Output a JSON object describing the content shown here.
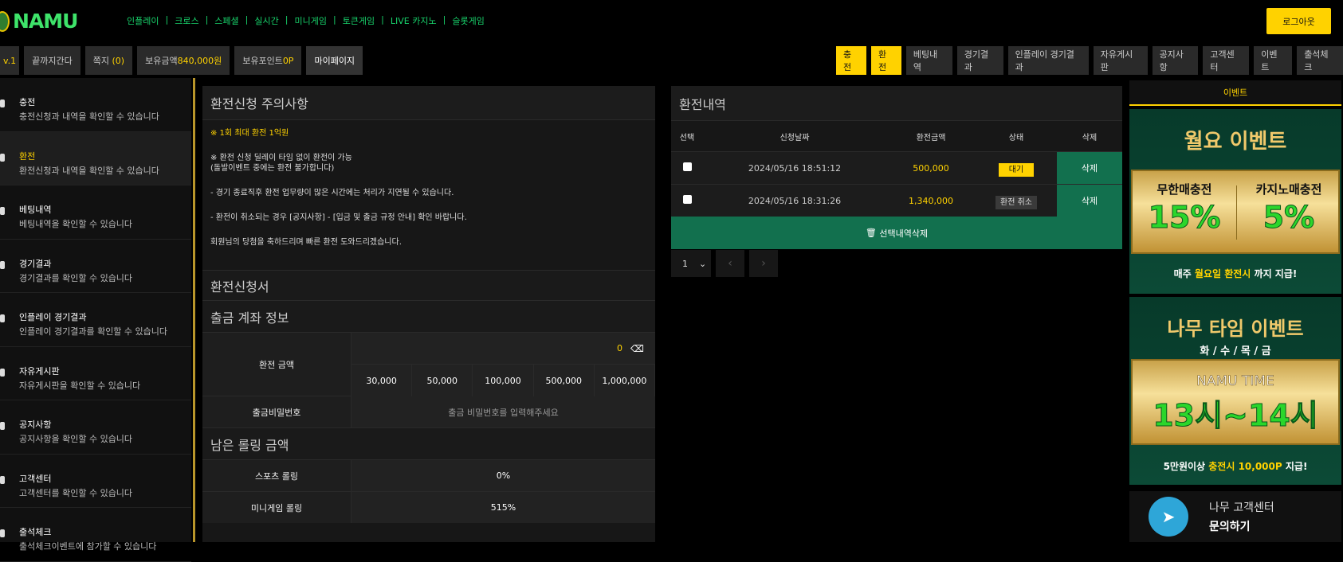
{
  "brand": {
    "name": "NAMU"
  },
  "gnb": [
    "인플레이",
    "크로스",
    "스페셜",
    "실시간",
    "미니게임",
    "토큰게임",
    "LIVE 카지노",
    "슬롯게임"
  ],
  "logout": "로그아웃",
  "userbar": {
    "level": "v.1",
    "nick": "끝까지간다",
    "msg_label": "쪽지",
    "msg_count": "(0)",
    "money_label": "보유금액",
    "money": "840,000원",
    "point_label": "보유포인트",
    "point": "0P",
    "mypage": "마이페이지"
  },
  "rnav": [
    "충전",
    "환전",
    "베팅내역",
    "경기결과",
    "인플레이 경기결과",
    "자유게시판",
    "공지사항",
    "고객센터",
    "이벤트",
    "출석체크"
  ],
  "side": [
    {
      "t": "충전",
      "d": "충전신청과 내역을 확인할 수 있습니다"
    },
    {
      "t": "환전",
      "d": "환전신청과 내역을 확인할 수 있습니다"
    },
    {
      "t": "베팅내역",
      "d": "베팅내역을 확인할 수 있습니다"
    },
    {
      "t": "경기결과",
      "d": "경기결과를 확인할 수 있습니다"
    },
    {
      "t": "인플레이 경기결과",
      "d": "인플레이 경기결과를 확인할 수 있습니다"
    },
    {
      "t": "자유게시판",
      "d": "자유게시판을 확인할 수 있습니다"
    },
    {
      "t": "공지사항",
      "d": "공지사항을 확인할 수 있습니다"
    },
    {
      "t": "고객센터",
      "d": "고객센터를 확인할 수 있습니다"
    },
    {
      "t": "출석체크",
      "d": "출석체크이벤트에 참가할 수 있습니다"
    }
  ],
  "notice": {
    "title": "환전신청 주의사항",
    "n1": "※ 1회 최대 환전 1억원",
    "n2a": "※ 환전 신청 딜레이 타임 없이 환전이 가능",
    "n2b": "(돌발이벤트 중에는 환전 불가합니다)",
    "n3": "- 경기 종료직후 환전 업무량이 많은 시간에는 처리가 지연될 수 있습니다.",
    "n4": "- 환전이 취소되는 경우 [공지사항] - [입금 및 출금 규정 안내] 확인 바랍니다.",
    "n5": "회원님의 당첨을 축하드리며 빠른 환전 도와드리겠습니다."
  },
  "form": {
    "title": "환전신청서",
    "acct": "출금 계좌 정보",
    "amount_label": "환전 금액",
    "amount_value": "0",
    "quick": [
      "30,000",
      "50,000",
      "100,000",
      "500,000",
      "1,000,000"
    ],
    "pw_label": "출금비밀번호",
    "pw_ph": "출금 비밀번호를 입력해주세요",
    "roll_title": "남은 롤링 금액",
    "roll": [
      {
        "k": "스포츠 롤링",
        "v": "0%"
      },
      {
        "k": "미니게임 롤링",
        "v": "515%"
      }
    ]
  },
  "hist": {
    "title": "환전내역",
    "cols": [
      "선택",
      "신청날짜",
      "환전금액",
      "상태",
      "삭제"
    ],
    "rows": [
      {
        "date": "2024/05/16 18:51:12",
        "amt": "500,000",
        "state": "대기",
        "del": "삭제"
      },
      {
        "date": "2024/05/16 18:31:26",
        "amt": "1,340,000",
        "state": "환전 취소",
        "del": "삭제"
      }
    ],
    "delall": "선택내역삭제",
    "page": "1"
  },
  "event": {
    "head": "이벤트",
    "b1": {
      "title": "월요 이벤트",
      "l1": "무한매충전",
      "v1": "15%",
      "l2": "카지노매충전",
      "v2": "5%",
      "foot_a": "매주",
      "foot_b": "월요일 환전시",
      "foot_c": "까지 지급!"
    },
    "b2": {
      "title": "나무 타임 이벤트",
      "days": "화 / 수 / 목 / 금",
      "name": "NAMU TIME",
      "time": "13시~14시",
      "foot_a": "5만원이상",
      "foot_b": "충전시 10,000P",
      "foot_c": "지급!"
    }
  },
  "help": {
    "t1": "나무 고객센터",
    "t2": "문의하기"
  }
}
